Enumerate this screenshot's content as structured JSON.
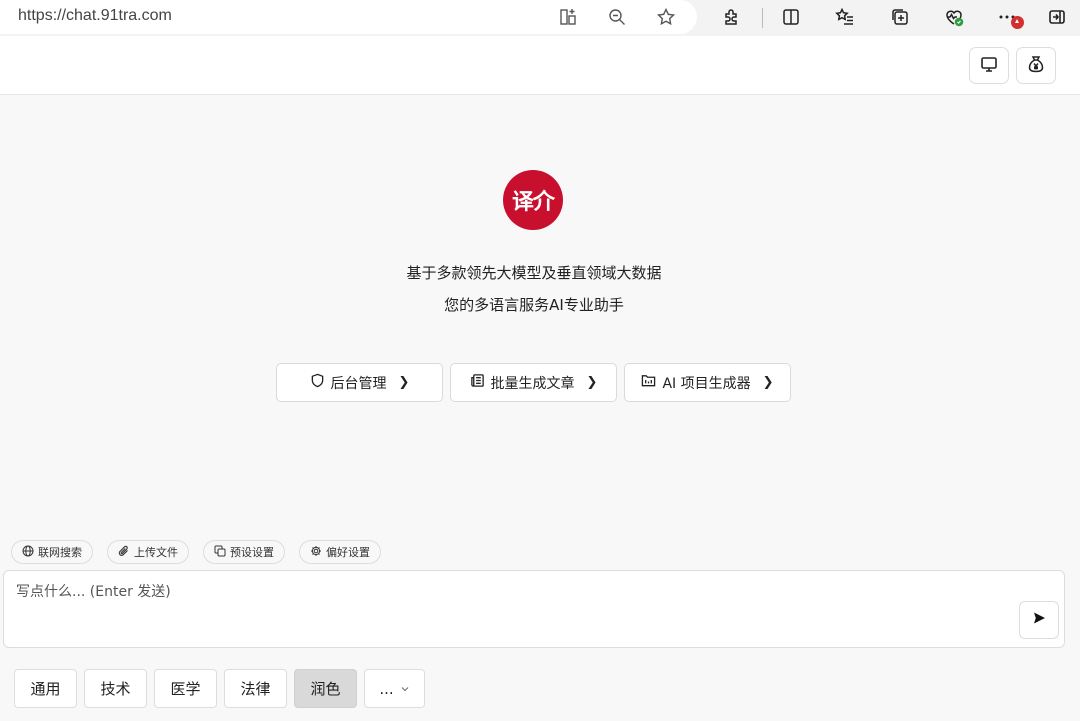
{
  "browser": {
    "url": "https://chat.91tra.com",
    "icons": [
      "split-screen-add-icon",
      "zoom-out-icon",
      "favorite-star-icon",
      "extensions-icon",
      "split-view-icon",
      "favorites-list-icon",
      "collections-icon",
      "browser-health-icon",
      "more-menu-icon",
      "sidebar-toggle-icon"
    ],
    "badge_color": "#d32f2f"
  },
  "header": {
    "buttons": [
      {
        "name": "monitor-icon"
      },
      {
        "name": "yuan-bag-icon"
      }
    ]
  },
  "hero": {
    "logo_text": "译介",
    "logo_color": "#c8102e",
    "line1": "基于多款领先大模型及垂直领域大数据",
    "line2": "您的多语言服务AI专业助手"
  },
  "actions": [
    {
      "label": "后台管理",
      "icon": "shield-icon"
    },
    {
      "label": "批量生成文章",
      "icon": "newspaper-icon"
    },
    {
      "label": "AI 项目生成器",
      "icon": "project-folder-icon"
    }
  ],
  "tools": [
    {
      "label": "联网搜索",
      "icon": "globe-icon"
    },
    {
      "label": "上传文件",
      "icon": "paperclip-icon"
    },
    {
      "label": "预设设置",
      "icon": "copy-icon"
    },
    {
      "label": "偏好设置",
      "icon": "gear-icon"
    }
  ],
  "composer": {
    "placeholder": "写点什么... (Enter 发送)"
  },
  "categories": [
    {
      "label": "通用",
      "active": false
    },
    {
      "label": "技术",
      "active": false
    },
    {
      "label": "医学",
      "active": false
    },
    {
      "label": "法律",
      "active": false
    },
    {
      "label": "润色",
      "active": true
    },
    {
      "label": "...",
      "active": false
    }
  ]
}
